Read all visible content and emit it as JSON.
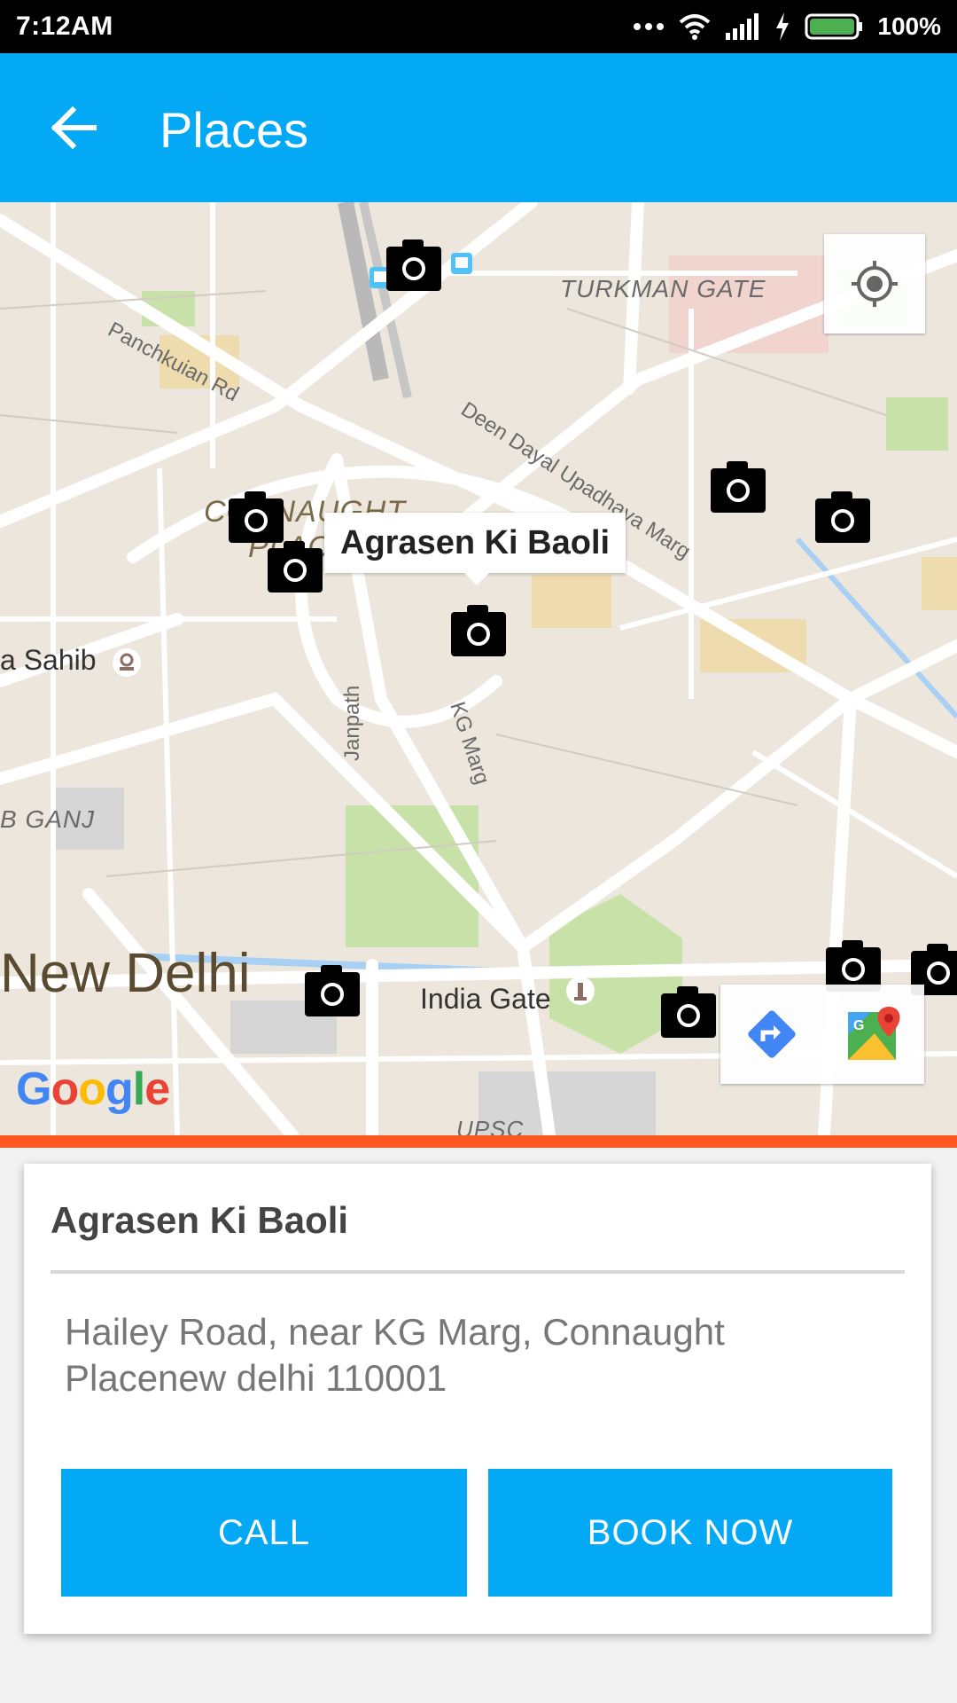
{
  "status_bar": {
    "time": "7:12AM",
    "battery_percent": "100%",
    "icons": [
      "more-dots-icon",
      "wifi-icon",
      "signal-icon",
      "charging-icon",
      "battery-icon"
    ]
  },
  "app_bar": {
    "title": "Places",
    "back_icon": "arrow-back-icon",
    "color": "#03a9f4"
  },
  "map": {
    "labels": {
      "turkman_gate": "TURKMAN GATE",
      "panchkuian_rd": "Panchkuian Rd",
      "deen_dayal": "Deen Dayal Upadhaya Marg",
      "connaught": "CONNAUGHT",
      "connaught2": "PLAC",
      "sahib": "a Sahib",
      "janpath": "Janpath",
      "kg_marg": "KG Marg",
      "b_ganj": "B GANJ",
      "new_delhi": "New Delhi",
      "india_gate": "India Gate",
      "upsc": "UPSC"
    },
    "selected_marker": "Agrasen Ki Baoli",
    "marker_icon": "camera-icon",
    "attribution": [
      "G",
      "o",
      "o",
      "g",
      "l",
      "e"
    ]
  },
  "accent_color": "#ff5722",
  "place_card": {
    "title": "Agrasen Ki Baoli",
    "address": "Hailey Road, near KG Marg, Connaught Placenew delhi 110001",
    "call_label": "CALL",
    "book_label": "BOOK NOW"
  }
}
